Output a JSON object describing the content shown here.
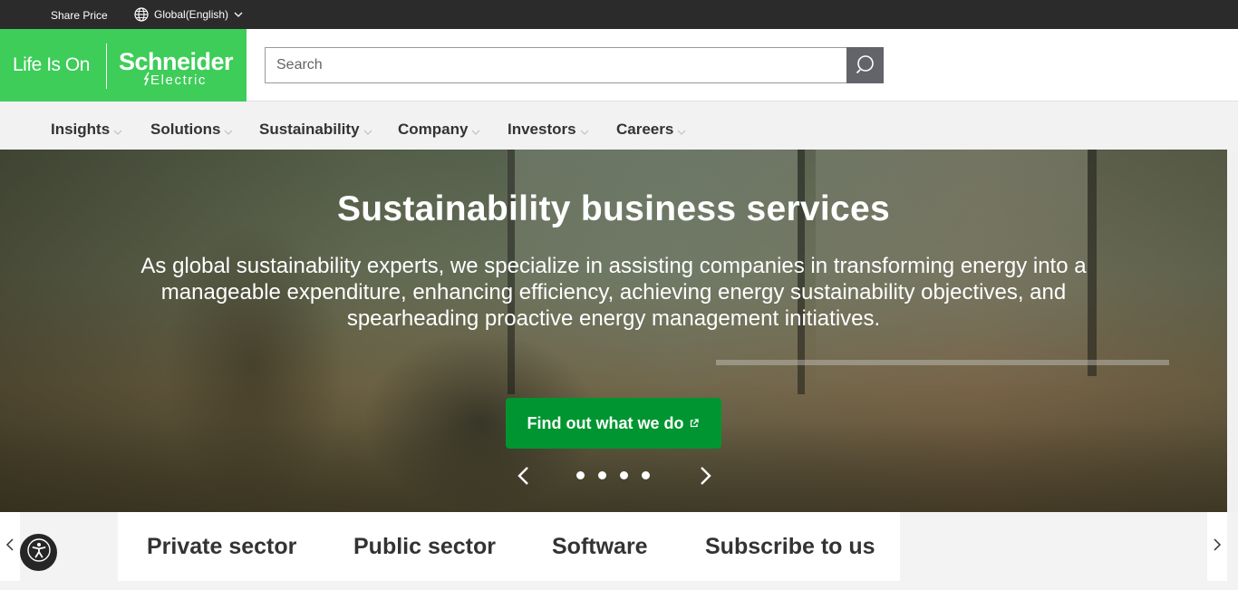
{
  "topbar": {
    "share_price": "Share Price",
    "language": "Global(English)"
  },
  "logo": {
    "tagline": "Life Is On",
    "brand": "Schneider",
    "brand_sub": "Electric"
  },
  "search": {
    "placeholder": "Search"
  },
  "nav": {
    "items": [
      {
        "label": "Insights"
      },
      {
        "label": "Solutions"
      },
      {
        "label": "Sustainability"
      },
      {
        "label": "Company"
      },
      {
        "label": "Investors"
      },
      {
        "label": "Careers"
      }
    ]
  },
  "hero": {
    "title": "Sustainability business services",
    "description": "As global sustainability experts, we specialize in assisting companies in transforming energy into a manageable expenditure, enhancing efficiency, achieving energy sustainability objectives, and spearheading proactive energy management initiatives.",
    "cta_label": "Find out what we do",
    "slide_count": 4,
    "active_slide": 1
  },
  "tabs": {
    "items": [
      {
        "label": "Private sector"
      },
      {
        "label": "Public sector"
      },
      {
        "label": "Software"
      },
      {
        "label": "Subscribe to us"
      }
    ]
  },
  "colors": {
    "brand_green": "#3dcd58",
    "cta_green": "#009530",
    "topbar": "#2b2b2b",
    "search_button": "#626469"
  }
}
